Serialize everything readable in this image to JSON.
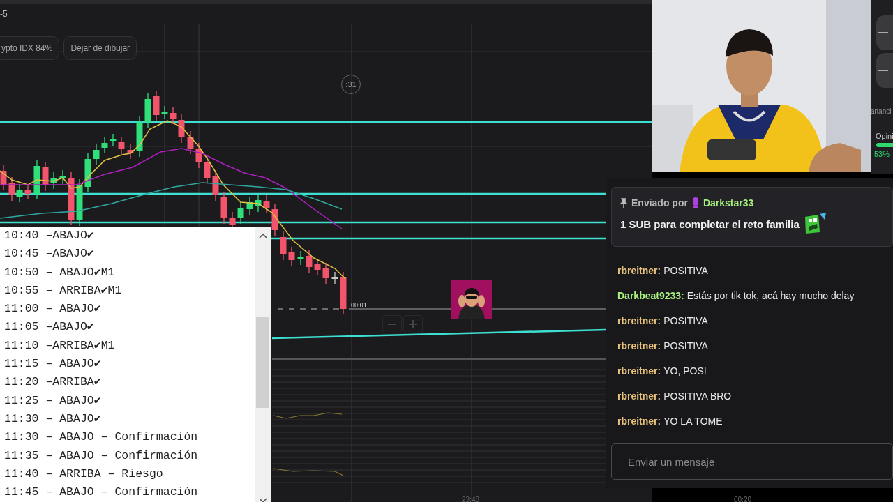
{
  "chart": {
    "title_fragment": "-5",
    "buttons": [
      "ypto IDX 84%",
      "Dejar de dibujar"
    ],
    "countdown": ":31",
    "timer": "00:01",
    "time_labels": [
      "23:48",
      "00:20"
    ]
  },
  "side_panel": {
    "label": "ananci",
    "opinion_label": "Opini",
    "opinion_value": "53%"
  },
  "notepad": {
    "lines": [
      "10:40 –ABAJO✔",
      "10:45 –ABAJO✔",
      "10:50 – ABAJO✔M1",
      "10:55 – ARRIBA✔M1",
      "11:00 – ABAJO✔",
      "11:05 –ABAJO✔",
      "11:10 –ARRIBA✔M1",
      "11:15 – ABAJO✔",
      "11:20 –ARRIBA✔",
      "11:25 – ABAJO✔",
      "11:30 – ABAJO✔",
      "11:30 – ABAJO – Confirmación",
      "11:35 – ABAJO – Confirmación",
      "11:40 – ARRIBA – Riesgo",
      "11:45 – ABAJO – Confirmación"
    ]
  },
  "chat": {
    "pinned": {
      "prefix": "Enviado por",
      "user": "Darkstar33",
      "message": "1 SUB para completar el reto familia"
    },
    "messages": [
      {
        "user": "rbreitner:",
        "color": "#e8c27c",
        "text": "POSITIVA"
      },
      {
        "user": "Darkbeat9233:",
        "color": "#a6f07c",
        "text": "Estás por tik tok, acá hay mucho delay"
      },
      {
        "user": "rbreitner:",
        "color": "#e8c27c",
        "text": "POSITIVA"
      },
      {
        "user": "rbreitner:",
        "color": "#e8c27c",
        "text": "POSITIVA"
      },
      {
        "user": "rbreitner:",
        "color": "#e8c27c",
        "text": "YO, POSI"
      },
      {
        "user": "rbreitner:",
        "color": "#e8c27c",
        "text": "POSITIVA BRO"
      },
      {
        "user": "rbreitner:",
        "color": "#e8c27c",
        "text": "YO LA TOME"
      }
    ],
    "input": {
      "placeholder": "Enviar un mensaje"
    }
  }
}
